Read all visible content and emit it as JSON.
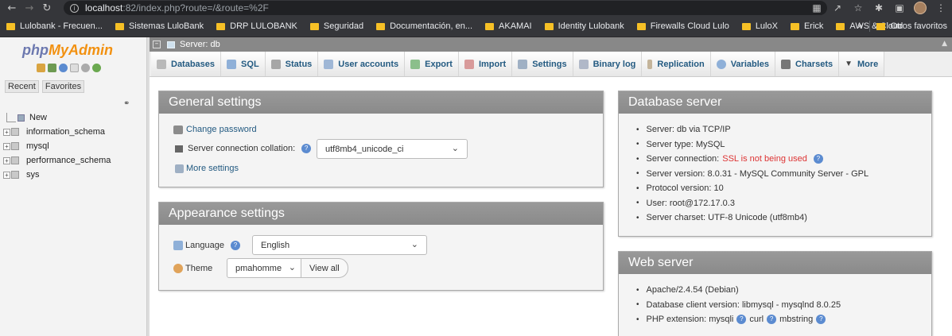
{
  "browser": {
    "url_host": "localhost",
    "url_rest": ":82/index.php?route=/&route=%2F",
    "bookmarks": [
      "Lulobank - Frecuen...",
      "Sistemas LuloBank",
      "DRP LULOBANK",
      "Seguridad",
      "Documentación, en...",
      "AKAMAI",
      "Identity Lulobank",
      "Firewalls Cloud Lulo",
      "LuloX",
      "Erick",
      "AWS & Cloud"
    ],
    "bookmarks_more": "»",
    "other_bookmarks": "Otros favoritos"
  },
  "nav": {
    "logo_php": "php",
    "logo_my": "MyAdmin",
    "tab_recent": "Recent",
    "tab_favorites": "Favorites",
    "new_label": "New",
    "databases": [
      "information_schema",
      "mysql",
      "performance_schema",
      "sys"
    ]
  },
  "breadcrumb": {
    "server": "Server: db"
  },
  "menu": [
    {
      "label": "Databases",
      "icon": "databases-icon",
      "color": "#b9b9b9"
    },
    {
      "label": "SQL",
      "icon": "sql-icon",
      "color": "#8fb0d8"
    },
    {
      "label": "Status",
      "icon": "status-icon",
      "color": "#a6a6a6"
    },
    {
      "label": "User accounts",
      "icon": "users-icon",
      "color": "#9fb7d6"
    },
    {
      "label": "Export",
      "icon": "export-icon",
      "color": "#8bbf8b"
    },
    {
      "label": "Import",
      "icon": "import-icon",
      "color": "#d89a9a"
    },
    {
      "label": "Settings",
      "icon": "settings-icon",
      "color": "#9fb0c4"
    },
    {
      "label": "Binary log",
      "icon": "binary-log-icon",
      "color": "#b0b8c8"
    },
    {
      "label": "Replication",
      "icon": "replication-icon",
      "color": "#c4b49a"
    },
    {
      "label": "Variables",
      "icon": "variables-icon",
      "color": "#8fb0d8"
    },
    {
      "label": "Charsets",
      "icon": "charsets-icon",
      "color": "#777777"
    },
    {
      "label": "More",
      "icon": "more-icon",
      "color": "#555555"
    }
  ],
  "general": {
    "title": "General settings",
    "change_password": "Change password",
    "collation_label": "Server connection collation:",
    "collation_value": "utf8mb4_unicode_ci",
    "more_settings": "More settings"
  },
  "appearance": {
    "title": "Appearance settings",
    "language_label": "Language",
    "language_value": "English",
    "theme_label": "Theme",
    "theme_value": "pmahomme",
    "view_all": "View all"
  },
  "dbserver": {
    "title": "Database server",
    "server": "Server: db via TCP/IP",
    "type": "Server type: MySQL",
    "connection_label": "Server connection:",
    "connection_value": "SSL is not being used",
    "version": "Server version: 8.0.31 - MySQL Community Server - GPL",
    "protocol": "Protocol version: 10",
    "user": "User: root@172.17.0.3",
    "charset": "Server charset: UTF-8 Unicode (utf8mb4)"
  },
  "webserver": {
    "title": "Web server",
    "apache": "Apache/2.4.54 (Debian)",
    "client": "Database client version: libmysql - mysqlnd 8.0.25",
    "php_ext_label": "PHP extension: mysqli",
    "php_ext_curl": "curl",
    "php_ext_mbstring": "mbstring"
  }
}
